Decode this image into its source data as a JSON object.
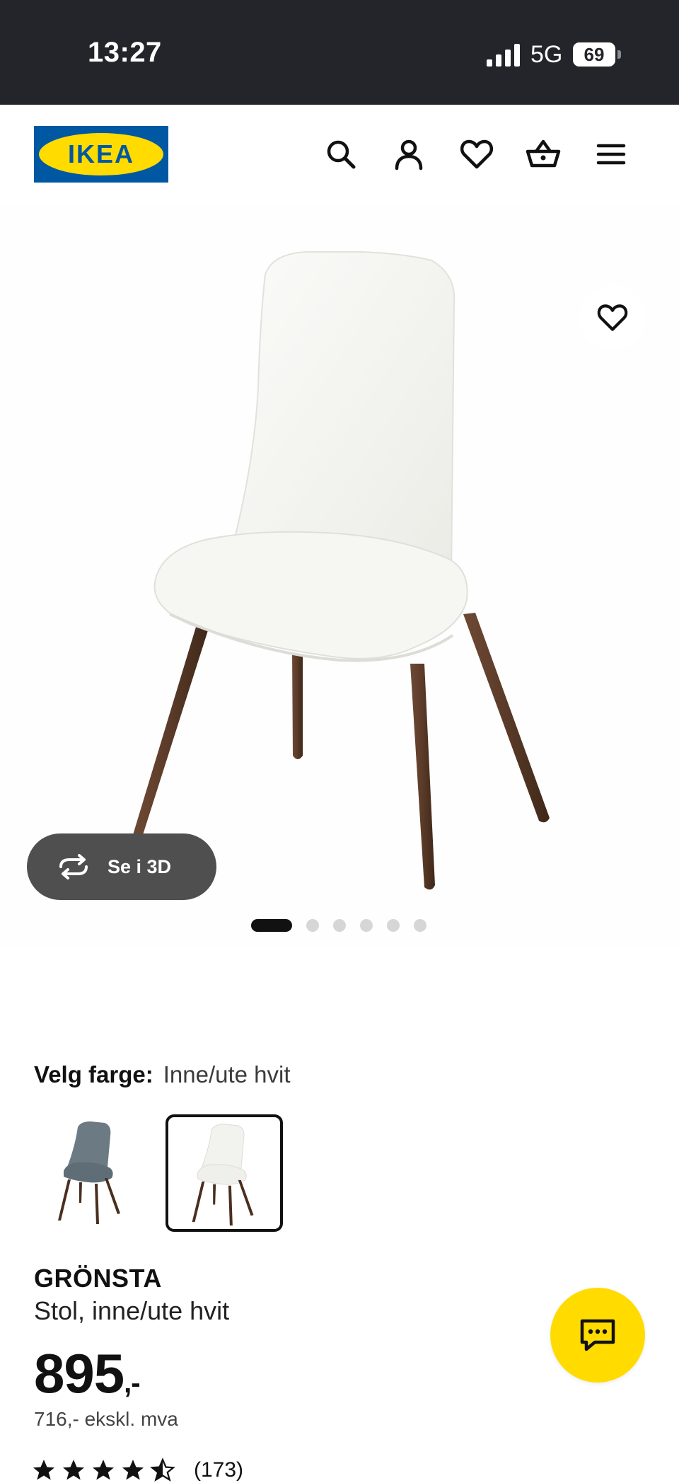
{
  "status_bar": {
    "time": "13:27",
    "network": "5G",
    "battery": "69"
  },
  "header": {
    "logo_text": "IKEA",
    "icons": [
      "search-icon",
      "account-icon",
      "favorites-icon",
      "cart-icon",
      "menu-icon"
    ]
  },
  "gallery": {
    "view3d_label": "Se i 3D",
    "image_count": 6,
    "active_index": 0
  },
  "color_picker": {
    "label": "Velg farge:",
    "selected_value": "Inne/ute hvit",
    "options": [
      "blue-grey",
      "white"
    ]
  },
  "product": {
    "name": "GRÖNSTA",
    "description": "Stol, inne/ute hvit",
    "price_main": "895",
    "price_suffix": ",-",
    "price_ex_vat": "716,- ekskl. mva",
    "rating_value": 4.5,
    "rating_count": "(173)"
  },
  "colors": {
    "brand_blue": "#0058a3",
    "brand_yellow": "#ffdb00",
    "status_bar_bg": "#23252a"
  }
}
